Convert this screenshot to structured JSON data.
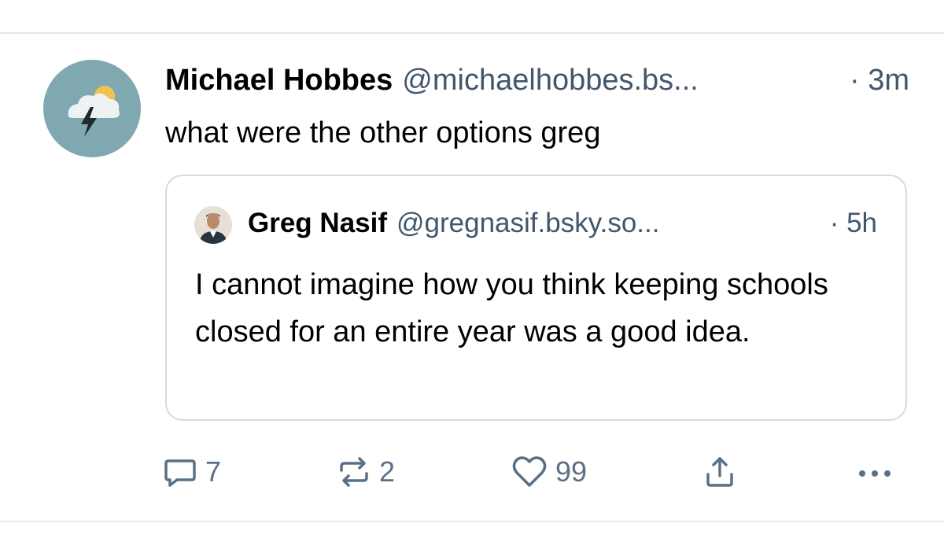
{
  "post": {
    "author_name": "Michael Hobbes",
    "author_handle": "@michaelhobbes.bs...",
    "time": "· 3m",
    "text": "what were the other options greg",
    "avatar_icon": "storm-cloud-sun-icon",
    "avatar_bg": "#7fa8b0"
  },
  "quote": {
    "author_name": "Greg Nasif",
    "author_handle": "@gregnasif.bsky.so...",
    "time": "· 5h",
    "text": "I cannot imagine how you think keeping schools closed for an entire year was a good idea."
  },
  "actions": {
    "reply_count": "7",
    "repost_count": "2",
    "like_count": "99",
    "icons": [
      "reply-icon",
      "repost-icon",
      "like-icon",
      "share-icon",
      "more-icon"
    ],
    "color": "#5b7086"
  },
  "colors": {
    "handle": "#42576c",
    "border": "#d4dbe2",
    "divider": "#e4e7eb"
  }
}
